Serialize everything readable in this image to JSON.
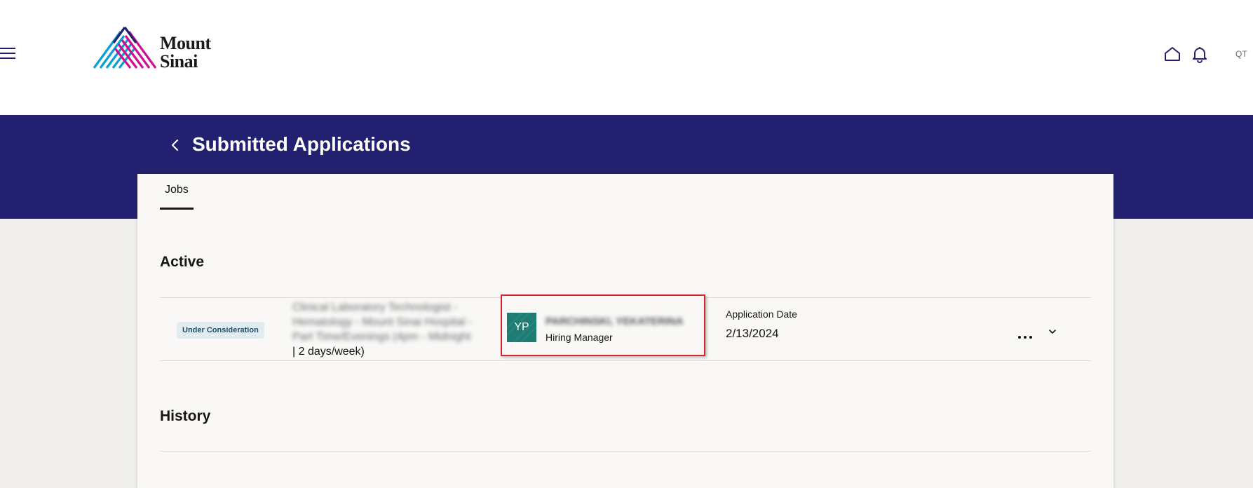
{
  "header": {
    "brand_line1": "Mount",
    "brand_line2": "Sinai",
    "user_initials": "QT",
    "icons": [
      "hamburger-menu-icon",
      "home-icon",
      "bell-icon"
    ]
  },
  "banner": {
    "title": "Submitted Applications",
    "back_icon": "chevron-left-icon"
  },
  "tabs": [
    {
      "label": "Jobs",
      "selected": true
    }
  ],
  "sections": {
    "active": "Active",
    "history": "History"
  },
  "application": {
    "status": "Under Consideration",
    "job_title_line1": "Clinical Laboratory Technologist -",
    "job_title_line2": "Hematology - Mount Sinai Hospital -",
    "job_title_line3": "Part Time/Evenings (4pm - Midnight",
    "job_title_line4": "| 2 days/week)",
    "contact_initials": "YP",
    "contact_name": "PARCHINSKI, YEKATERINA",
    "contact_role": "Hiring Manager",
    "date_label": "Application Date",
    "date_value": "2/13/2024"
  },
  "colors": {
    "banner": "#23206f",
    "page_bg": "#efeeec",
    "card_bg": "#f9f8f6",
    "avatar": "#1f7c74",
    "badge_bg": "#e0ecf0",
    "badge_text": "#1d4e69",
    "highlight_border": "#d8242d",
    "logo_cyan": "#06a0d6",
    "logo_magenta": "#d10f8e",
    "logo_navy": "#221f72"
  }
}
